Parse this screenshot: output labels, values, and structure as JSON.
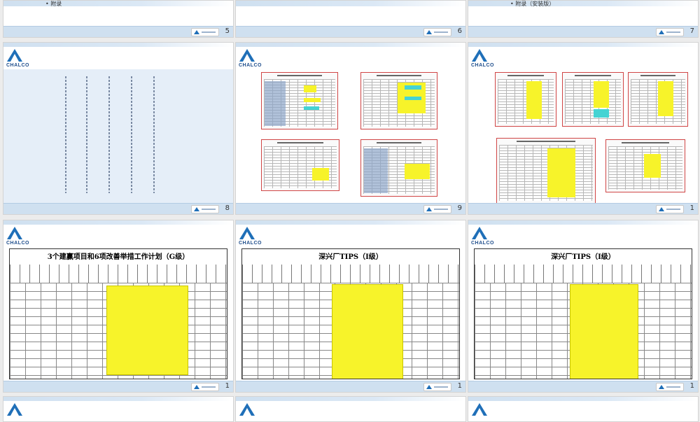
{
  "brand": {
    "logo_text": "CHALCO"
  },
  "colors": {
    "accent": "#1f6fb8",
    "highlight": "#f7f32a",
    "cyan": "#45d3d3",
    "thumb_border": "#d04545"
  },
  "top_row": [
    {
      "bullet": "• 附录",
      "page": "5"
    },
    {
      "bullet": "",
      "page": "6"
    },
    {
      "bullet": "• 附录（安装版）",
      "page": "7"
    }
  ],
  "mid_row": [
    {
      "page": "8"
    },
    {
      "page": "9"
    },
    {
      "page": "1"
    }
  ],
  "bottom_row_pages": [
    {
      "title": "3个建赢项目和6项改善举措工作计划（G级）",
      "page": "1"
    },
    {
      "title": "深兴厂TIPS（I级）",
      "page": "1"
    },
    {
      "title": "深兴厂TIPS（I级）",
      "page": "1"
    }
  ],
  "icons": {
    "logo": "chalco-logo-icon",
    "footer_logo": "chalco-footer-logo-icon"
  }
}
